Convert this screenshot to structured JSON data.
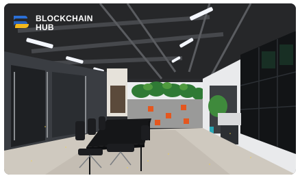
{
  "brand": {
    "line1": "BLOCKCHAIN",
    "line2": "HUB",
    "colors": {
      "mark_blue": "#2b6fd6",
      "mark_yellow": "#f3b81c",
      "text": "#ffffff"
    }
  },
  "scene": {
    "description_icons": [
      "office-photo"
    ],
    "colors": {
      "ceiling": "#262729",
      "floor": "#cfc9bf",
      "wall_white": "#e9eaec",
      "plants": "#2f7a35",
      "orange_blocks": "#e4571f"
    }
  }
}
